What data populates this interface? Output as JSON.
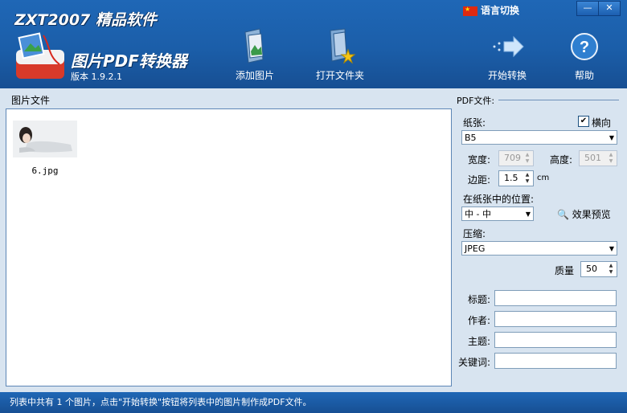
{
  "header": {
    "brand": "ZXT2007 精品软件",
    "product": "图片PDF转换器",
    "version": "版本 1.9.2.1",
    "language_label": "语言切换",
    "toolbar": {
      "add_images": "添加图片",
      "open_folder": "打开文件夹",
      "start_convert": "开始转换",
      "help": "帮助"
    },
    "window_buttons": {
      "minimize": "—",
      "close": "✕"
    }
  },
  "left_panel": {
    "title": "图片文件",
    "files": [
      {
        "name": "6.jpg"
      }
    ]
  },
  "right_panel": {
    "title": "PDF文件:",
    "paper_label": "纸张:",
    "landscape_label": "横向",
    "landscape_checked": true,
    "paper_value": "B5",
    "width_label": "宽度:",
    "width_value": "709",
    "height_label": "高度:",
    "height_value": "501",
    "margin_label": "边距:",
    "margin_value": "1.5",
    "margin_unit": "cm",
    "position_label": "在纸张中的位置:",
    "position_value": "中 - 中",
    "preview_label": "效果预览",
    "compress_label": "压缩:",
    "compress_value": "JPEG",
    "quality_label": "质量",
    "quality_value": "50",
    "meta_title_label": "标题:",
    "meta_author_label": "作者:",
    "meta_subject_label": "主题:",
    "meta_keywords_label": "关键词:"
  },
  "status": "列表中共有 1 个图片，点击\"开始转换\"按钮将列表中的图片制作成PDF文件。",
  "colors": {
    "header_blue": "#1b5ea9",
    "panel_bg": "#d8e4f0",
    "border_blue": "#5d86b6"
  }
}
